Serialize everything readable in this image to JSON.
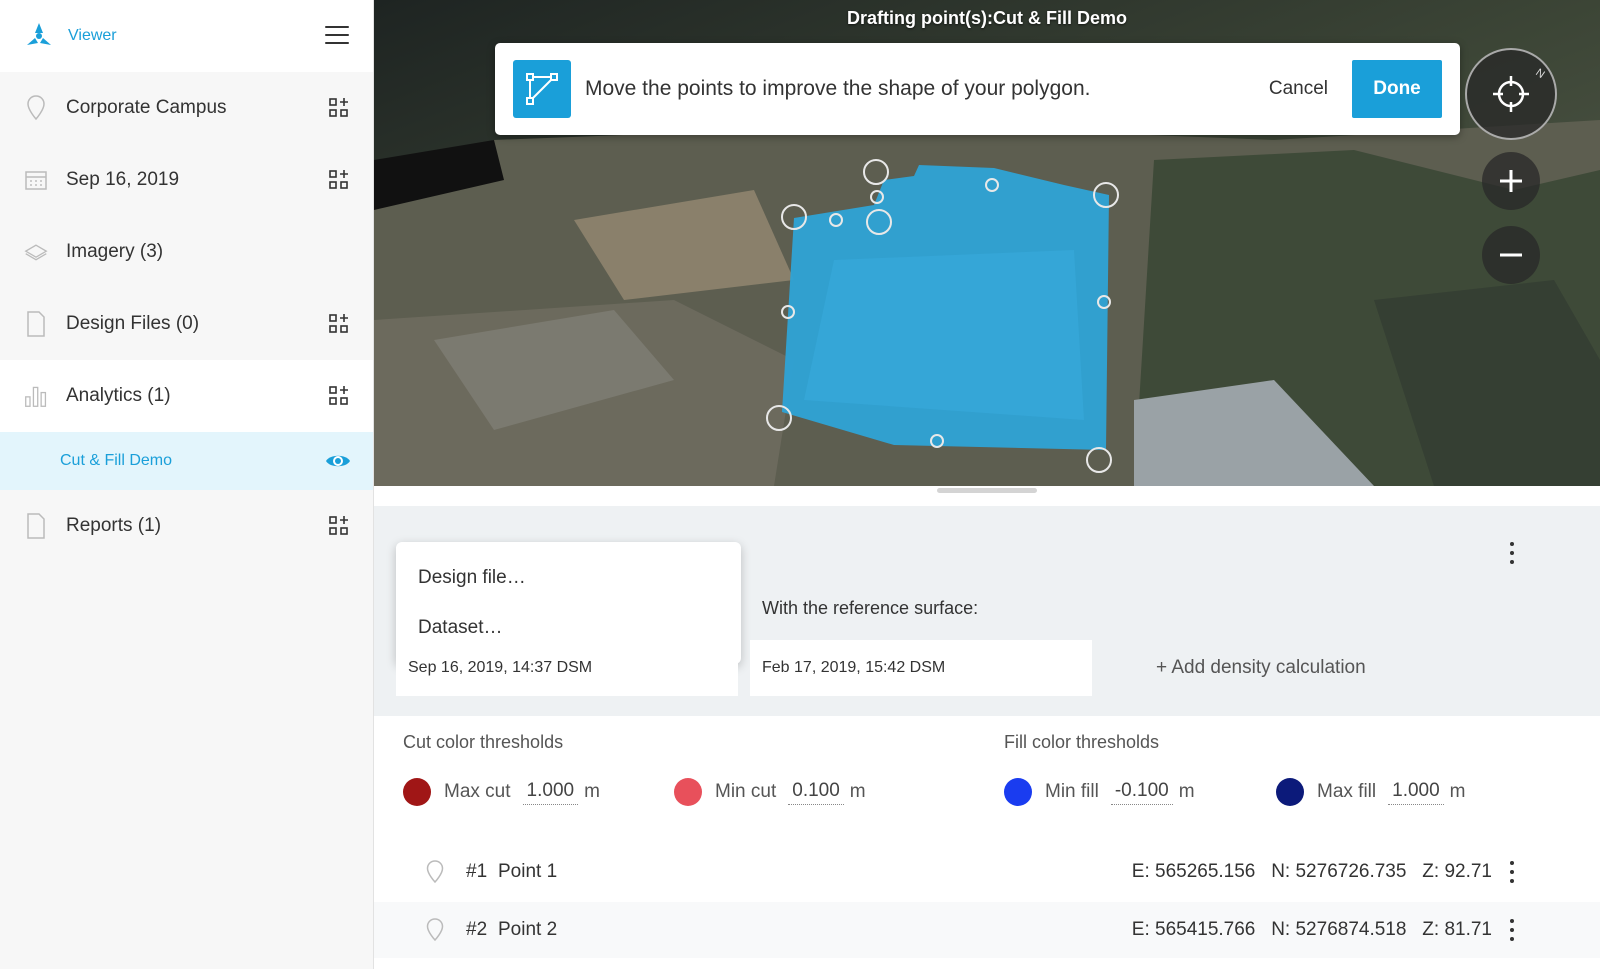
{
  "sidebar": {
    "app_title": "Viewer",
    "items": [
      {
        "label": "Corporate Campus"
      },
      {
        "label": "Sep 16, 2019"
      },
      {
        "label": "Imagery (3)"
      },
      {
        "label": "Design Files (0)"
      },
      {
        "label": "Analytics (1)"
      },
      {
        "label": "Reports (1)"
      }
    ],
    "active_sub": {
      "label": "Cut & Fill Demo"
    }
  },
  "map": {
    "title": "Drafting point(s):Cut & Fill Demo",
    "banner": {
      "message": "Move the points to improve the shape of your polygon.",
      "cancel_label": "Cancel",
      "done_label": "Done"
    }
  },
  "panel": {
    "menu_options": [
      "Design file…",
      "Dataset…"
    ],
    "reference_label": "With the reference surface:",
    "surface_a": "Sep 16, 2019, 14:37 DSM",
    "surface_b": "Feb 17, 2019, 15:42 DSM",
    "add_density": "+ Add density calculation",
    "cut_title": "Cut color thresholds",
    "fill_title": "Fill color thresholds",
    "thresholds": [
      {
        "label": "Max cut",
        "value": "1.000",
        "unit": "m",
        "color": "#a01616"
      },
      {
        "label": "Min cut",
        "value": "0.100",
        "unit": "m",
        "color": "#e8505b"
      },
      {
        "label": "Min fill",
        "value": "-0.100",
        "unit": "m",
        "color": "#1a3cf0"
      },
      {
        "label": "Max fill",
        "value": "1.000",
        "unit": "m",
        "color": "#0c1a7a"
      }
    ],
    "points": [
      {
        "num": "#1",
        "name": "Point 1",
        "coords": "E: 565265.156   N: 5276726.735   Z: 92.71"
      },
      {
        "num": "#2",
        "name": "Point 2",
        "coords": "E: 565415.766   N: 5276874.518   Z: 81.71"
      }
    ]
  },
  "colors": {
    "accent": "#1a9fd9",
    "selected_bg": "#e3f5fc"
  }
}
